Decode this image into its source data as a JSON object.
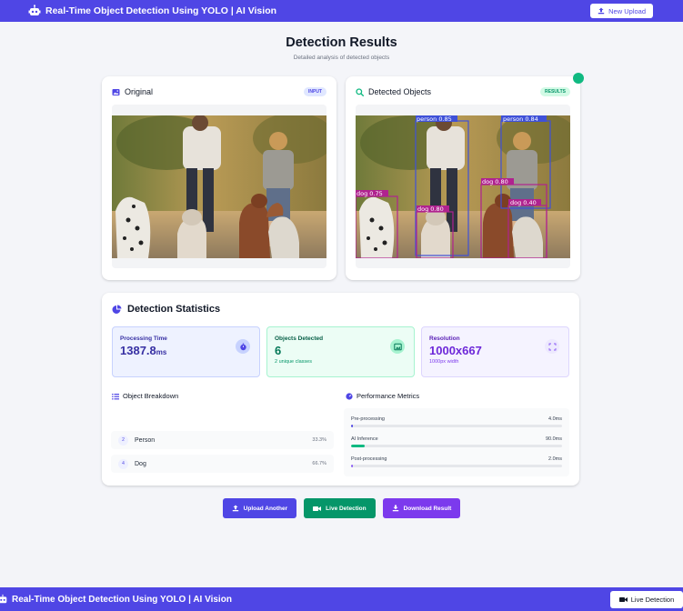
{
  "app": {
    "title": "Real-Time Object Detection Using YOLO | AI Vision",
    "new_upload": "New Upload",
    "brand_color": "#4f46e5"
  },
  "header": {
    "title": "Detection Results",
    "subtitle": "Detailed analysis of detected objects"
  },
  "original": {
    "title": "Original",
    "badge": "INPUT",
    "icon": "image-icon"
  },
  "detected": {
    "title": "Detected Objects",
    "badge": "RESULTS",
    "icon": "search-icon",
    "boxes": [
      {
        "label": "person 0.85",
        "color": "#3f51d8"
      },
      {
        "label": "person 0.84",
        "color": "#3f51d8"
      },
      {
        "label": "dog 0.75",
        "color": "#b0228f"
      },
      {
        "label": "dog 0.80",
        "color": "#b0228f"
      },
      {
        "label": "dog 0.80",
        "color": "#b0228f"
      },
      {
        "label": "dog 0.40",
        "color": "#b0228f"
      }
    ]
  },
  "stats": {
    "title": "Detection Statistics",
    "processing": {
      "label": "Processing Time",
      "value": "1387.8",
      "unit": "ms",
      "icon": "stopwatch-icon"
    },
    "objects": {
      "label": "Objects Detected",
      "value": "6",
      "sub": "2 unique classes",
      "icon": "image-icon"
    },
    "resolution": {
      "label": "Resolution",
      "value": "1000x667",
      "sub": "1000px width",
      "icon": "expand-icon"
    }
  },
  "breakdown": {
    "title": "Object Breakdown",
    "items": [
      {
        "count": "2",
        "name": "Person",
        "pct": "33.3%"
      },
      {
        "count": "4",
        "name": "Dog",
        "pct": "66.7%"
      }
    ]
  },
  "performance": {
    "title": "Performance Metrics",
    "metrics": [
      {
        "label": "Pre-processing",
        "value": "4.0ms",
        "fraction": 0.004,
        "color": "#4f46e5"
      },
      {
        "label": "AI Inference",
        "value": "90.0ms",
        "fraction": 0.065,
        "color": "#10b981"
      },
      {
        "label": "Post-processing",
        "value": "2.0ms",
        "fraction": 0.002,
        "color": "#8b5cf6"
      }
    ]
  },
  "actions": {
    "upload_another": "Upload Another",
    "live_detection": "Live Detection",
    "download_result": "Download Result"
  },
  "bottom": {
    "title": "Real-Time Object Detection Using YOLO | AI Vision",
    "live_detection": "Live Detection"
  }
}
